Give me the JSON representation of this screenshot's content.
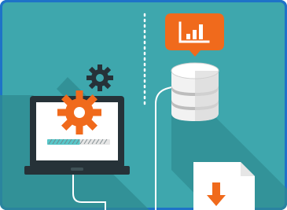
{
  "illustration": {
    "colors": {
      "background": "#3ea7ad",
      "shadow": "#2f8a90",
      "frame_border": "#1e73c8",
      "dark": "#263238",
      "white": "#ffffff",
      "orange": "#f06a1c",
      "progress": "#58c7c9",
      "database_light": "#f2f2f2",
      "database_mid": "#d9d9d9",
      "database_dark": "#bdbdbd"
    },
    "icons": [
      "laptop-icon",
      "gear-icon",
      "database-icon",
      "bar-chart-icon",
      "download-document-icon"
    ],
    "progress_fraction": 0.52
  }
}
